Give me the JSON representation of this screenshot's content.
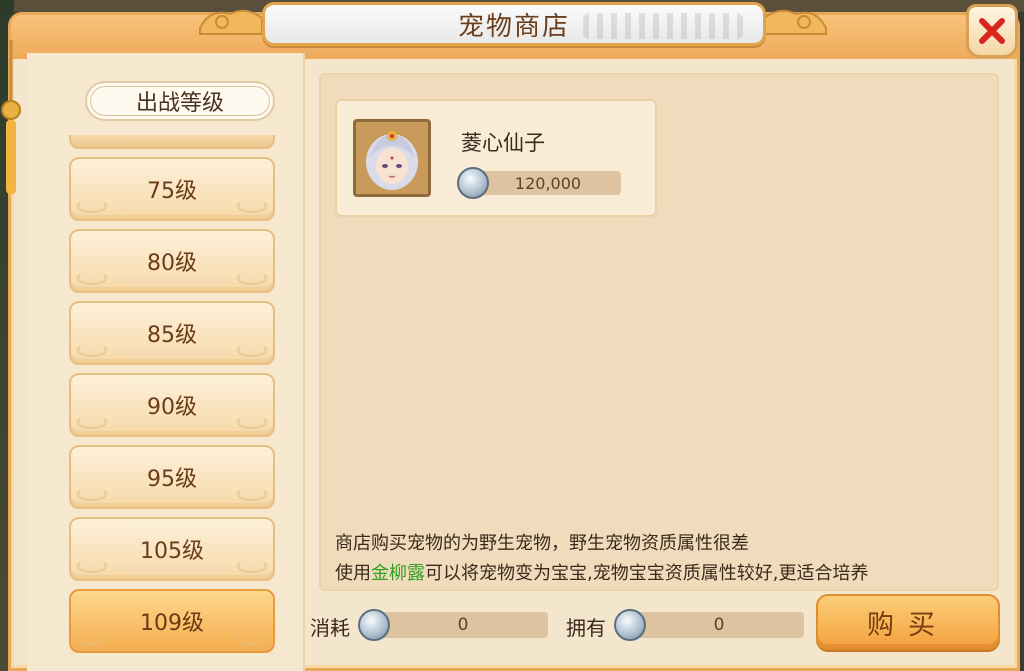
{
  "window": {
    "title": "宠物商店"
  },
  "sidebar": {
    "header": "出战等级",
    "levels": [
      {
        "label": "75级",
        "active": false
      },
      {
        "label": "80级",
        "active": false
      },
      {
        "label": "85级",
        "active": false
      },
      {
        "label": "90级",
        "active": false
      },
      {
        "label": "95级",
        "active": false
      },
      {
        "label": "105级",
        "active": false
      },
      {
        "label": "109级",
        "active": true
      }
    ]
  },
  "shop": {
    "items": [
      {
        "name": "菱心仙子",
        "price": "120,000",
        "currency_icon": "silver-coin-icon"
      }
    ],
    "notice_line1": "商店购买宠物的为野生宠物，野生宠物资质属性很差",
    "notice_line2_prefix": "使用",
    "notice_line2_highlight": "金柳露",
    "notice_line2_suffix": "可以将宠物变为宝宝,宠物宝宝资质属性较好,更适合培养",
    "highlight_color": "#2ea01e"
  },
  "footer": {
    "cost_label": "消耗",
    "cost_value": "0",
    "own_label": "拥有",
    "own_value": "0",
    "buy_label": "购买"
  },
  "colors": {
    "accent": "#f3a03c",
    "panel": "#f4e6cc",
    "text": "#3b2a1c"
  }
}
